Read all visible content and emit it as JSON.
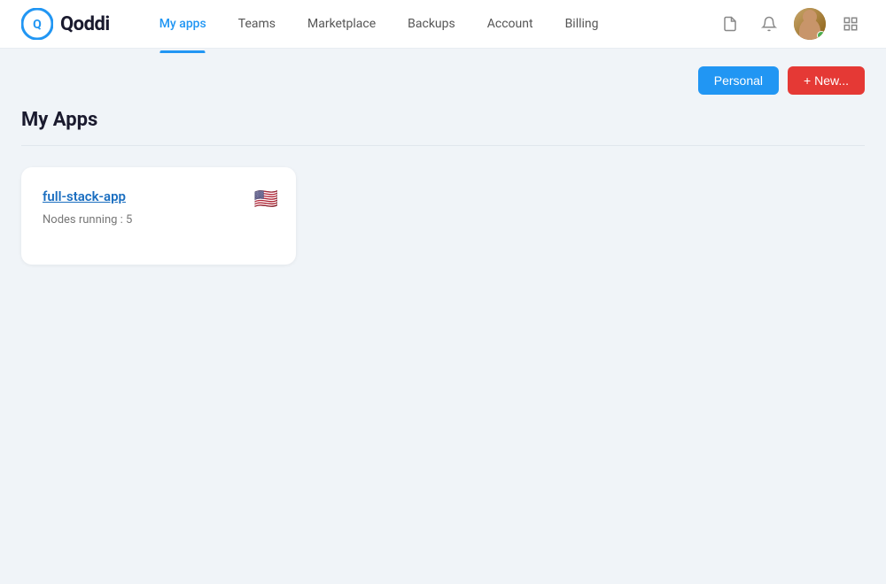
{
  "header": {
    "logo_text": "Qoddi",
    "nav": {
      "items": [
        {
          "label": "My apps",
          "active": true
        },
        {
          "label": "Teams",
          "active": false
        },
        {
          "label": "Marketplace",
          "active": false
        },
        {
          "label": "Backups",
          "active": false
        },
        {
          "label": "Account",
          "active": false
        },
        {
          "label": "Billing",
          "active": false
        }
      ]
    }
  },
  "toolbar": {
    "personal_label": "Personal",
    "new_label": "+ New..."
  },
  "page": {
    "title": "My Apps"
  },
  "apps": [
    {
      "name": "full-stack-app",
      "nodes_label": "Nodes running : 5",
      "flag": "🇺🇸"
    }
  ]
}
